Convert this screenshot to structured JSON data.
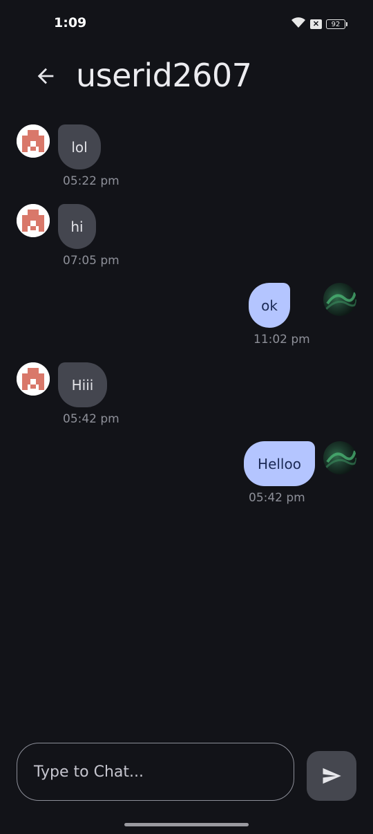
{
  "status_bar": {
    "time": "1:09",
    "battery": "92"
  },
  "header": {
    "title": "userid2607"
  },
  "messages": [
    {
      "sender": "them",
      "text": "lol",
      "time": "05:22 pm"
    },
    {
      "sender": "them",
      "text": "hi",
      "time": "07:05 pm"
    },
    {
      "sender": "me",
      "text": "ok",
      "time": "11:02 pm"
    },
    {
      "sender": "them",
      "text": "Hiii",
      "time": "05:42 pm"
    },
    {
      "sender": "me",
      "text": "Helloo",
      "time": "05:42 pm"
    }
  ],
  "composer": {
    "placeholder": "Type to Chat..."
  },
  "colors": {
    "background": "#121318",
    "bubble_them": "#44464f",
    "bubble_me": "#b4c5ff",
    "timestamp": "#8e9099"
  }
}
